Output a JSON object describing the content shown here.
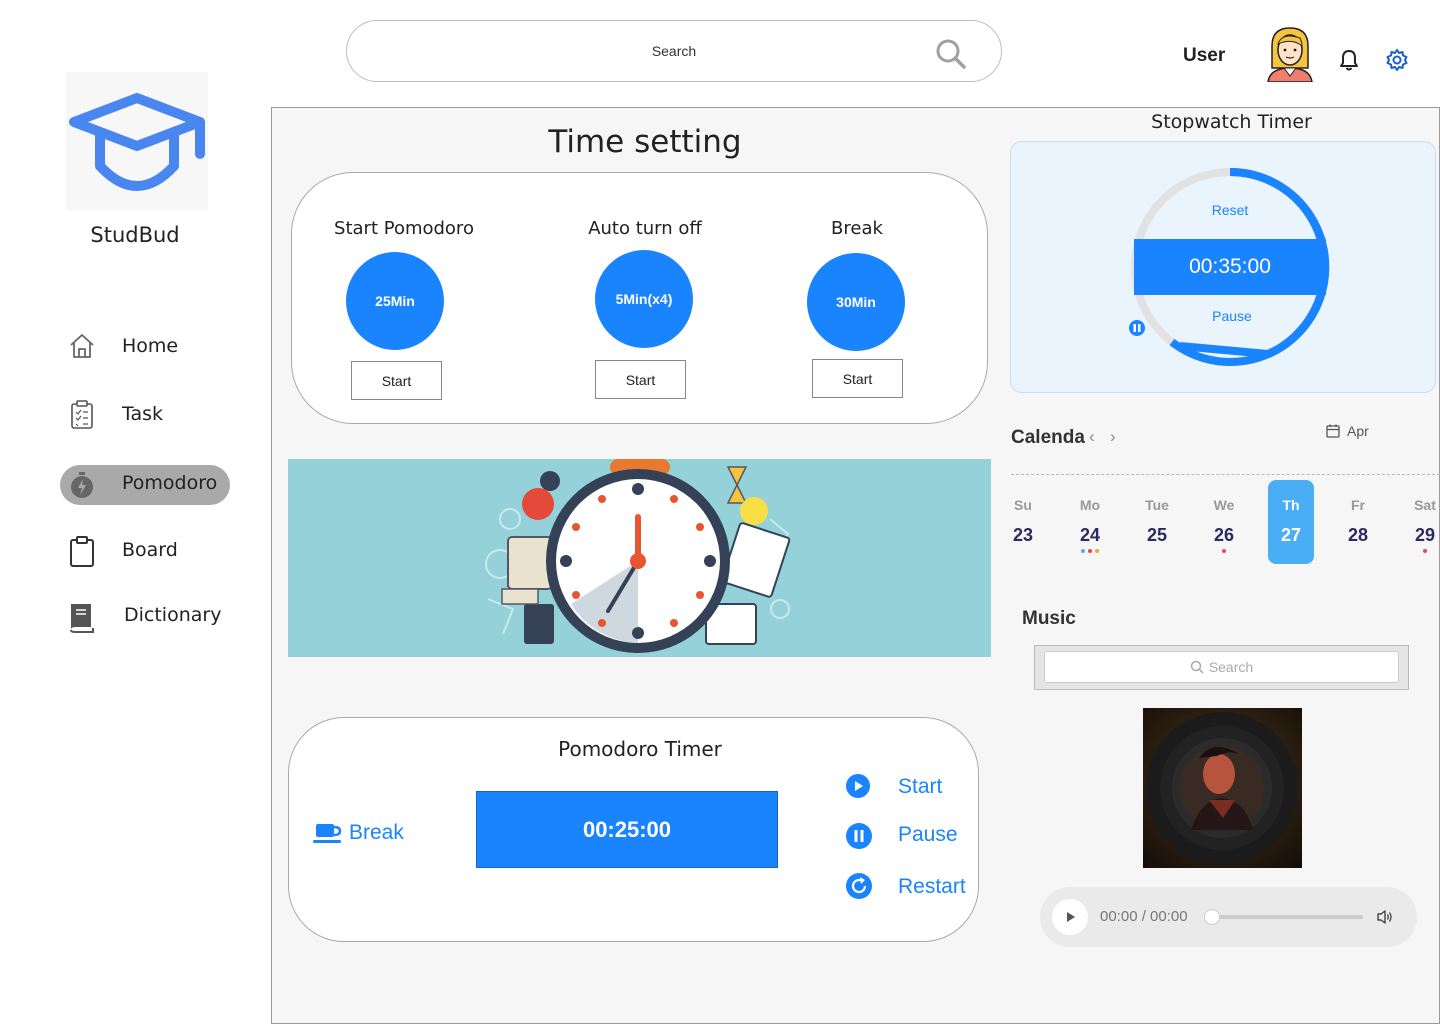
{
  "header": {
    "search_placeholder": "Search",
    "user_label": "User"
  },
  "sidebar": {
    "app_name": "StudBud",
    "items": [
      {
        "label": "Home",
        "icon": "home-icon",
        "active": false
      },
      {
        "label": "Task",
        "icon": "clipboard-icon",
        "active": false
      },
      {
        "label": "Pomodoro",
        "icon": "stopwatch-icon",
        "active": true
      },
      {
        "label": "Board",
        "icon": "board-icon",
        "active": false
      },
      {
        "label": "Dictionary",
        "icon": "book-icon",
        "active": false
      }
    ]
  },
  "time_setting": {
    "title": "Time setting",
    "columns": [
      {
        "title": "Start Pomodoro",
        "value": "25Min",
        "button": "Start"
      },
      {
        "title": "Auto turn off",
        "value": "5Min(x4)",
        "button": "Start"
      },
      {
        "title": "Break",
        "value": "30Min",
        "button": "Start"
      }
    ]
  },
  "pomodoro_timer": {
    "title": "Pomodoro Timer",
    "break_label": "Break",
    "display": "00:25:00",
    "controls": [
      {
        "label": "Start",
        "icon": "play-circle-icon"
      },
      {
        "label": "Pause",
        "icon": "pause-circle-icon"
      },
      {
        "label": "Restart",
        "icon": "restart-icon"
      }
    ]
  },
  "stopwatch": {
    "title": "Stopwatch Timer",
    "reset_label": "Reset",
    "display": "00:35:00",
    "pause_label": "Pause",
    "accent": "#1a84ff"
  },
  "calendar": {
    "title": "Calenda",
    "month": "Apr",
    "days": [
      {
        "name": "Su",
        "date": "23",
        "dots": []
      },
      {
        "name": "Mo",
        "date": "24",
        "dots": [
          "#4aaef5",
          "#e8455a",
          "#f5a623"
        ]
      },
      {
        "name": "Tue",
        "date": "25",
        "dots": []
      },
      {
        "name": "We",
        "date": "26",
        "dots": [
          "#e8455a"
        ]
      },
      {
        "name": "Th",
        "date": "27",
        "dots": [],
        "today": true
      },
      {
        "name": "Fr",
        "date": "28",
        "dots": []
      },
      {
        "name": "Sat",
        "date": "29",
        "dots": [
          "#e8455a"
        ]
      }
    ]
  },
  "music": {
    "title": "Music",
    "search_placeholder": "Search",
    "player_time": "00:00 / 00:00"
  },
  "colors": {
    "accent": "#1a84ff",
    "banner_bg": "#94d1d9",
    "active_nav": "#a9a9a9"
  }
}
